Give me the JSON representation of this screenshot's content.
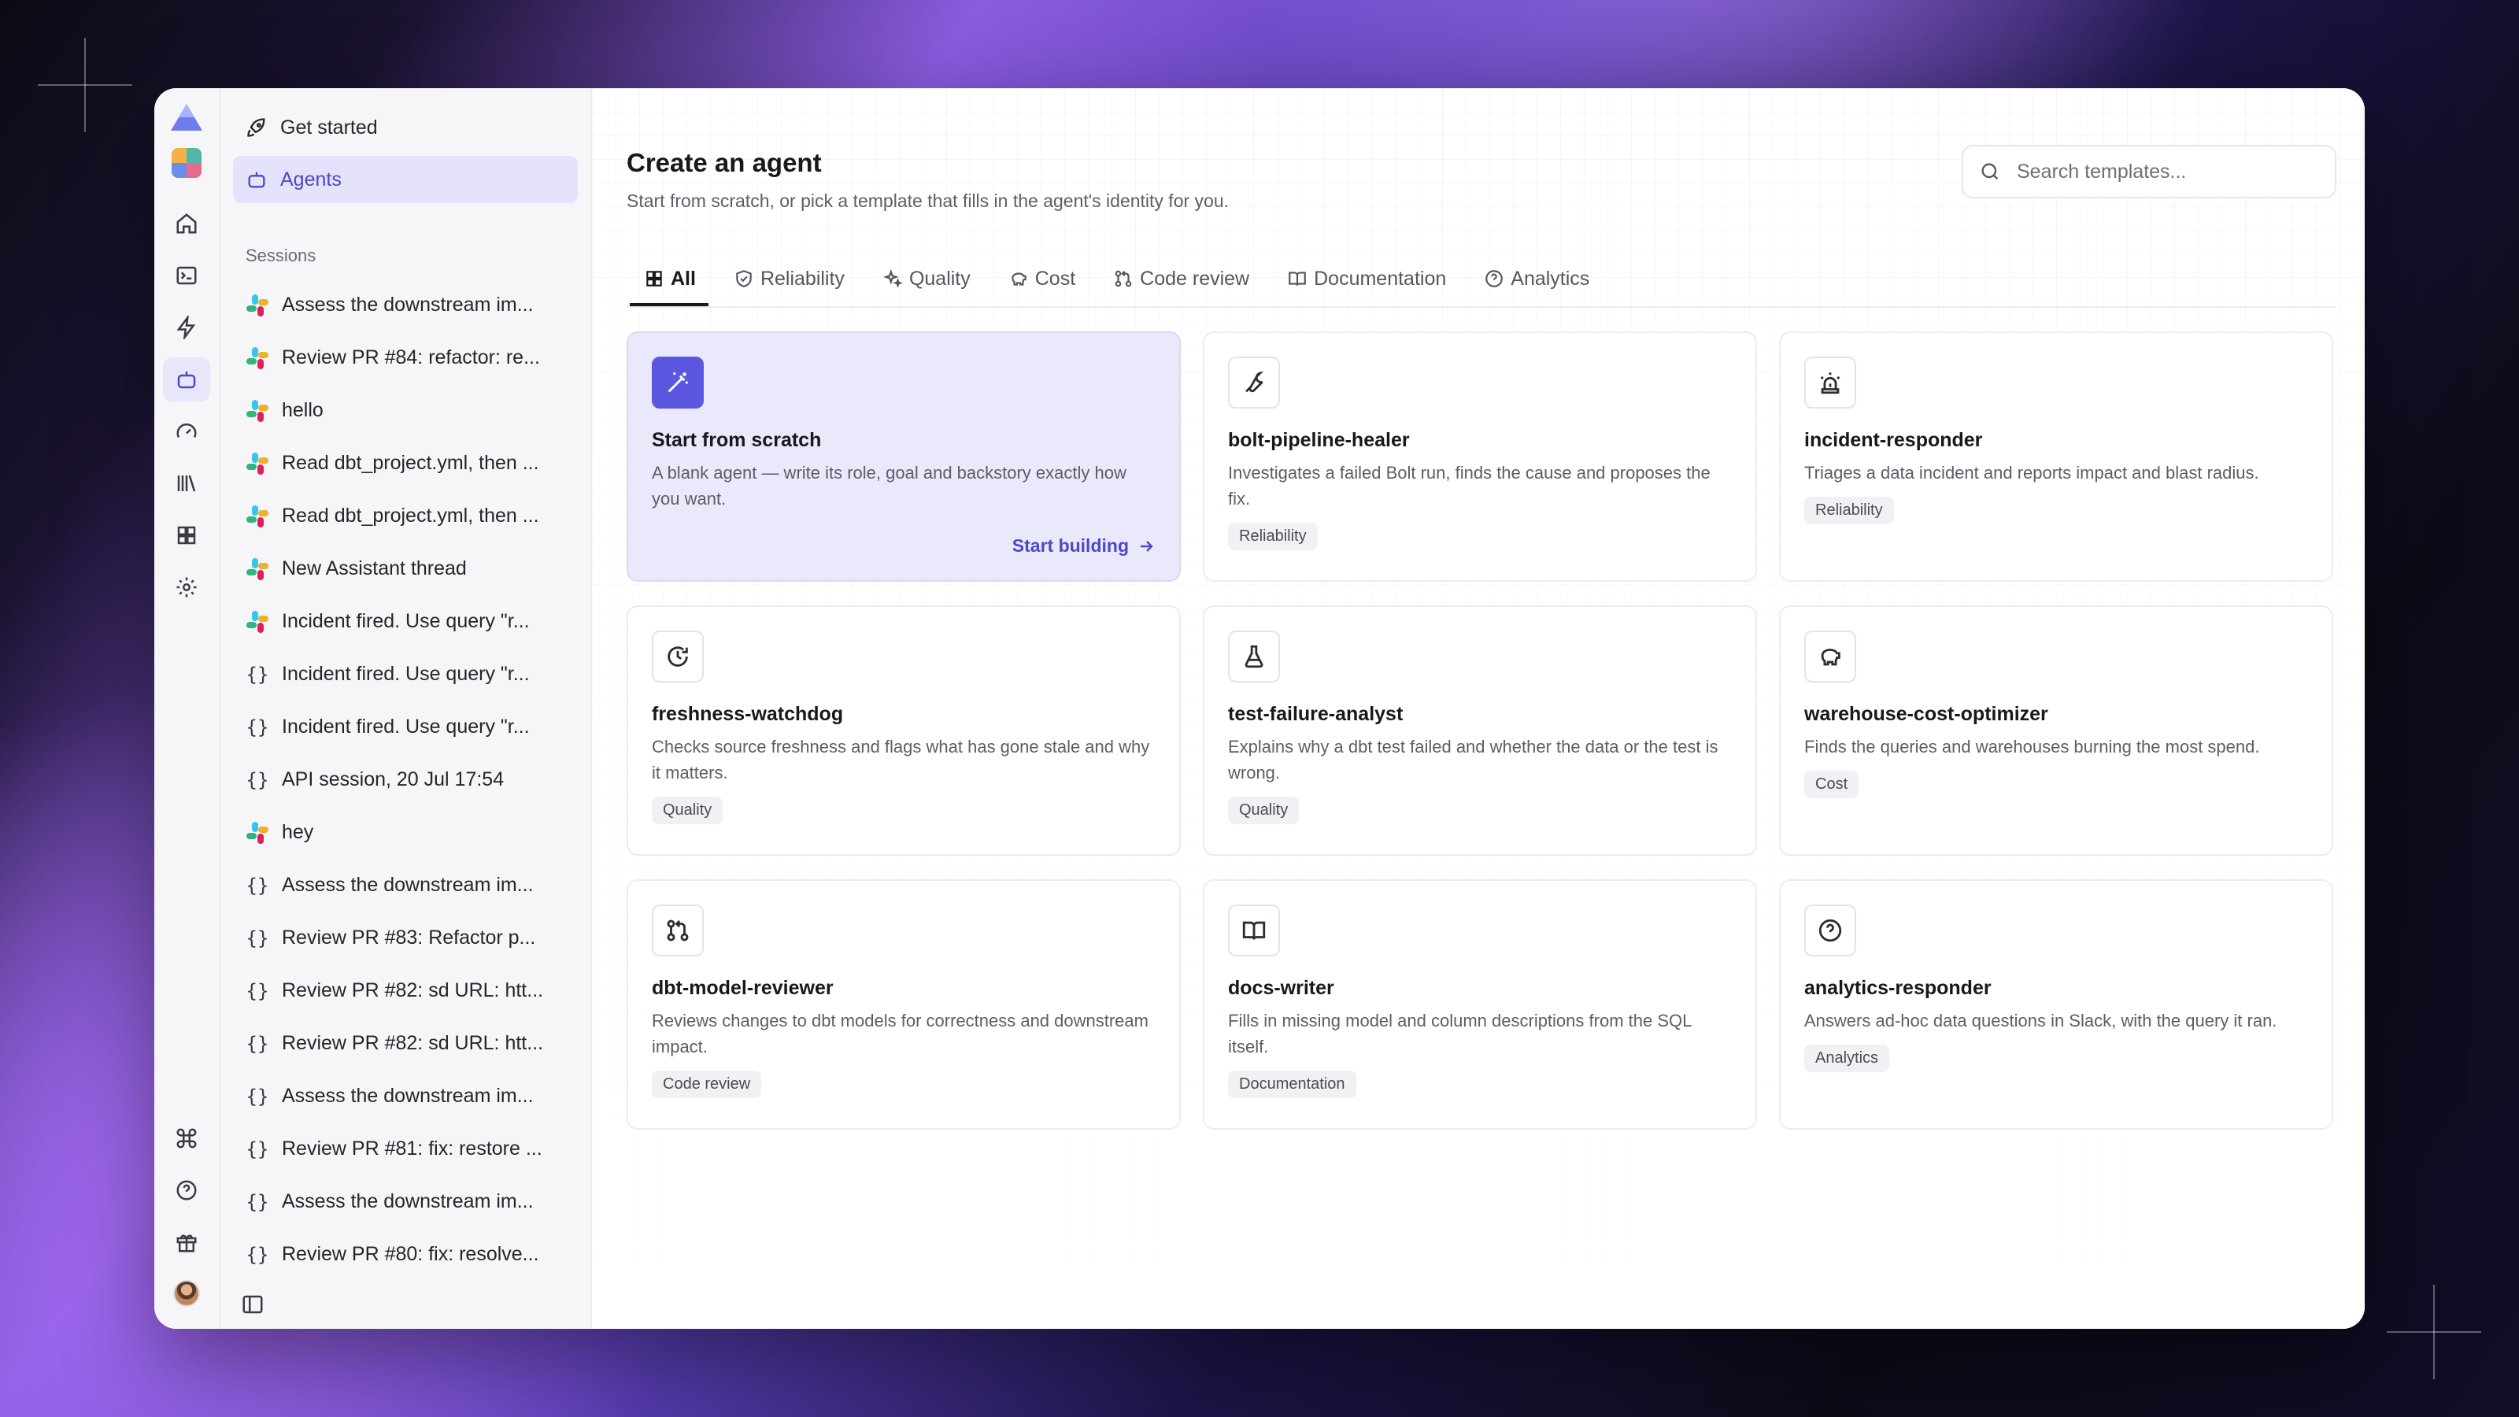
{
  "sidebar": {
    "nav": [
      {
        "label": "Get started",
        "icon": "rocket-icon"
      },
      {
        "label": "Agents",
        "icon": "bot-icon",
        "active": true
      }
    ],
    "sessions_heading": "Sessions",
    "sessions": [
      {
        "label": "Assess the downstream im...",
        "source": "slack"
      },
      {
        "label": "Review PR #84: refactor: re...",
        "source": "slack"
      },
      {
        "label": "hello",
        "source": "slack"
      },
      {
        "label": "Read dbt_project.yml, then ...",
        "source": "slack"
      },
      {
        "label": "Read dbt_project.yml, then ...",
        "source": "slack"
      },
      {
        "label": "New Assistant thread",
        "source": "slack"
      },
      {
        "label": "Incident fired. Use query \"r...",
        "source": "slack"
      },
      {
        "label": "Incident fired. Use query \"r...",
        "source": "api"
      },
      {
        "label": "Incident fired. Use query \"r...",
        "source": "api"
      },
      {
        "label": "API session, 20 Jul 17:54",
        "source": "api"
      },
      {
        "label": "hey",
        "source": "slack"
      },
      {
        "label": "Assess the downstream im...",
        "source": "api"
      },
      {
        "label": "Review PR #83: Refactor p...",
        "source": "api"
      },
      {
        "label": "Review PR #82: sd URL: htt...",
        "source": "api"
      },
      {
        "label": "Review PR #82: sd URL: htt...",
        "source": "api"
      },
      {
        "label": "Assess the downstream im...",
        "source": "api"
      },
      {
        "label": "Review PR #81: fix: restore ...",
        "source": "api"
      },
      {
        "label": "Assess the downstream im...",
        "source": "api"
      },
      {
        "label": "Review PR #80: fix: resolve...",
        "source": "api"
      }
    ],
    "api_glyph": "{}"
  },
  "main": {
    "title": "Create an agent",
    "subtitle": "Start from scratch, or pick a template that fills in the agent's identity for you.",
    "search_placeholder": "Search templates...",
    "tabs": [
      {
        "label": "All",
        "icon": "grid-icon",
        "active": true
      },
      {
        "label": "Reliability",
        "icon": "shield-check-icon"
      },
      {
        "label": "Quality",
        "icon": "sparkles-icon"
      },
      {
        "label": "Cost",
        "icon": "piggy-bank-icon"
      },
      {
        "label": "Code review",
        "icon": "git-pull-request-icon"
      },
      {
        "label": "Documentation",
        "icon": "book-icon"
      },
      {
        "label": "Analytics",
        "icon": "help-circle-icon"
      }
    ],
    "cards": [
      {
        "title": "Start from scratch",
        "desc": "A blank agent — write its role, goal and backstory exactly how you want.",
        "cta": "Start building",
        "icon": "magic-wand-icon"
      },
      {
        "title": "bolt-pipeline-healer",
        "desc": "Investigates a failed Bolt run, finds the cause and proposes the fix.",
        "tag": "Reliability",
        "icon": "wrench-icon"
      },
      {
        "title": "incident-responder",
        "desc": "Triages a data incident and reports impact and blast radius.",
        "tag": "Reliability",
        "icon": "siren-icon"
      },
      {
        "title": "freshness-watchdog",
        "desc": "Checks source freshness and flags what has gone stale and why it matters.",
        "tag": "Quality",
        "icon": "clock-icon"
      },
      {
        "title": "test-failure-analyst",
        "desc": "Explains why a dbt test failed and whether the data or the test is wrong.",
        "tag": "Quality",
        "icon": "flask-icon"
      },
      {
        "title": "warehouse-cost-optimizer",
        "desc": "Finds the queries and warehouses burning the most spend.",
        "tag": "Cost",
        "icon": "piggy-bank-icon"
      },
      {
        "title": "dbt-model-reviewer",
        "desc": "Reviews changes to dbt models for correctness and downstream impact.",
        "tag": "Code review",
        "icon": "git-pull-request-icon"
      },
      {
        "title": "docs-writer",
        "desc": "Fills in missing model and column descriptions from the SQL itself.",
        "tag": "Documentation",
        "icon": "book-icon"
      },
      {
        "title": "analytics-responder",
        "desc": "Answers ad-hoc data questions in Slack, with the query it ran.",
        "tag": "Analytics",
        "icon": "help-circle-icon"
      }
    ]
  },
  "colors": {
    "accent": "#5b57e0",
    "active_bg": "#e4e3fb",
    "featured_card_bg": "#e9e9fb"
  }
}
